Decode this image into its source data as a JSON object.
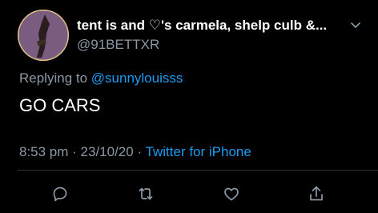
{
  "author": {
    "display_name": "tent is and ♡'s carmela, shelp culb &...",
    "handle": "@91BETTXR"
  },
  "reply": {
    "prefix": "Replying to ",
    "mention": "@sunnylouisss"
  },
  "tweet": {
    "text": "GO CARS"
  },
  "meta": {
    "time": "8:53 pm",
    "separator1": " · ",
    "date": "23/10/20",
    "separator2": " · ",
    "source": "Twitter for iPhone"
  },
  "icons": {
    "reply": "reply-icon",
    "retweet": "retweet-icon",
    "like": "heart-icon",
    "share": "share-icon",
    "more": "chevron-down-icon"
  },
  "colors": {
    "background": "#000000",
    "accent": "#1d9bf0",
    "secondary_text": "#8b98a5",
    "primary_text": "#ffffff"
  }
}
